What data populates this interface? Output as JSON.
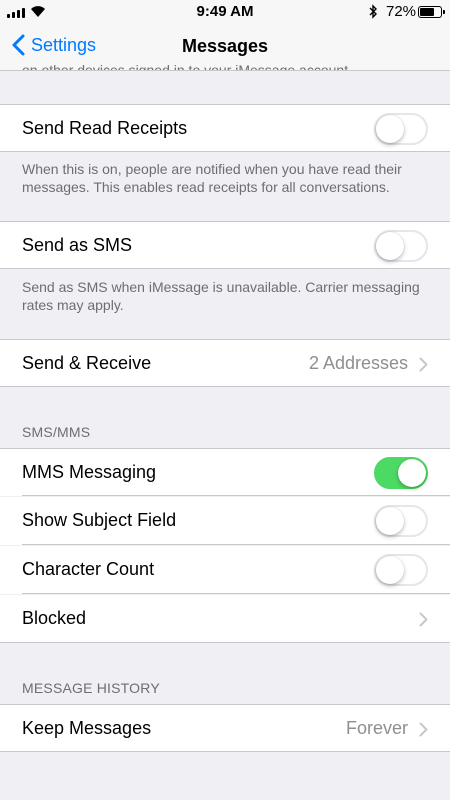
{
  "status_bar": {
    "time": "9:49 AM",
    "battery_percent_label": "72%",
    "battery_level": 0.72,
    "icons": [
      "signal-icon",
      "wifi-icon",
      "bluetooth-icon",
      "battery-icon"
    ]
  },
  "nav": {
    "back_label": "Settings",
    "title": "Messages",
    "scrolled_text": "on other devices signed in to your iMessage account."
  },
  "colors": {
    "accent": "#007aff",
    "toggle_on": "#4cd964",
    "background": "#efeff4",
    "secondary_text": "#6d6d72"
  },
  "rows": {
    "read_receipts": {
      "label": "Send Read Receipts",
      "on": false
    },
    "read_receipts_footer": "When this is on, people are notified when you have read their messages. This enables read receipts for all conversations.",
    "send_as_sms": {
      "label": "Send as SMS",
      "on": false
    },
    "send_as_sms_footer": "Send as SMS when iMessage is unavailable. Carrier messaging rates may apply.",
    "send_receive": {
      "label": "Send & Receive",
      "detail": "2 Addresses"
    }
  },
  "sms_section": {
    "header": "SMS/MMS",
    "mms": {
      "label": "MMS Messaging",
      "on": true
    },
    "subject": {
      "label": "Show Subject Field",
      "on": false
    },
    "char_count": {
      "label": "Character Count",
      "on": false
    },
    "blocked": {
      "label": "Blocked"
    }
  },
  "history_section": {
    "header": "MESSAGE HISTORY",
    "keep": {
      "label": "Keep Messages",
      "detail": "Forever"
    }
  }
}
